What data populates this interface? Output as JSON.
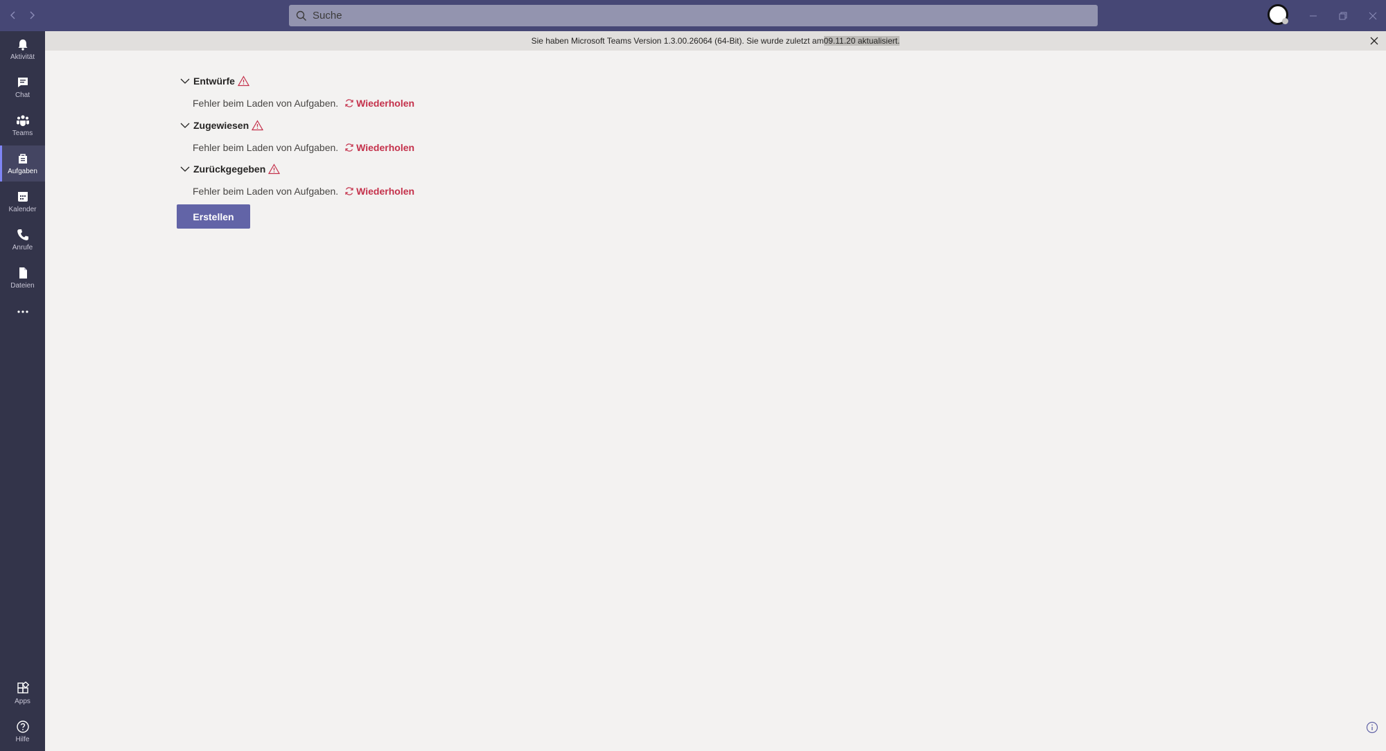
{
  "colors": {
    "titlebar": "#464775",
    "rail": "#33344a",
    "accent": "#6264a7",
    "error": "#c4314b",
    "background": "#f3f2f1"
  },
  "titlebar": {
    "back_icon": "arrow-left-icon",
    "forward_icon": "arrow-right-icon",
    "search_placeholder": "Suche",
    "window_buttons": [
      "minimize-icon",
      "restore-icon",
      "close-icon"
    ]
  },
  "rail": {
    "items": [
      {
        "label": "Aktivität",
        "icon": "bell-icon"
      },
      {
        "label": "Chat",
        "icon": "chat-icon"
      },
      {
        "label": "Teams",
        "icon": "teams-icon"
      },
      {
        "label": "Aufgaben",
        "icon": "assignments-icon",
        "active": true
      },
      {
        "label": "Kalender",
        "icon": "calendar-icon"
      },
      {
        "label": "Anrufe",
        "icon": "phone-icon"
      },
      {
        "label": "Dateien",
        "icon": "files-icon"
      }
    ],
    "more_icon": "more-icon",
    "bottom": [
      {
        "label": "Apps",
        "icon": "apps-icon"
      },
      {
        "label": "Hilfe",
        "icon": "help-icon"
      }
    ]
  },
  "banner": {
    "text": "Sie haben Microsoft Teams Version 1.3.00.26064 (64-Bit). Sie wurde zuletzt am ",
    "highlight": "09.11.20 aktualisiert.",
    "close_icon": "close-icon"
  },
  "sections": [
    {
      "title": "Entwürfe",
      "error": "Fehler beim Laden von Aufgaben.",
      "retry": "Wiederholen"
    },
    {
      "title": "Zugewiesen",
      "error": "Fehler beim Laden von Aufgaben.",
      "retry": "Wiederholen"
    },
    {
      "title": "Zurückgegeben",
      "error": "Fehler beim Laden von Aufgaben.",
      "retry": "Wiederholen"
    }
  ],
  "create_button": "Erstellen"
}
